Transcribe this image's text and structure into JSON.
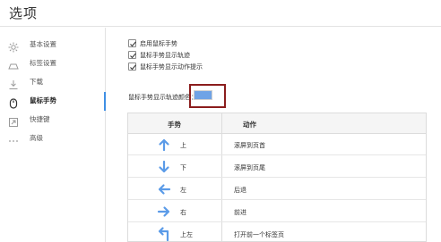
{
  "header": {
    "title": "选项"
  },
  "sidebar": {
    "items": [
      {
        "label": "基本设置",
        "icon": "gear-icon"
      },
      {
        "label": "标签设置",
        "icon": "tab-icon"
      },
      {
        "label": "下载",
        "icon": "download-icon"
      },
      {
        "label": "鼠标手势",
        "icon": "mouse-icon",
        "active": true
      },
      {
        "label": "快捷键",
        "icon": "shortcut-icon"
      },
      {
        "label": "高级",
        "icon": "more-icon"
      }
    ]
  },
  "options": [
    {
      "label": "启用鼠标手势",
      "checked": true
    },
    {
      "label": "鼠标手势显示轨迹",
      "checked": true
    },
    {
      "label": "鼠标手势显示动作提示",
      "checked": true
    }
  ],
  "trail_color": {
    "label": "鼠标手势显示轨迹颜色：",
    "value": "#6fa3e6"
  },
  "gesture_table": {
    "headers": {
      "gesture": "手势",
      "action": "动作"
    },
    "rows": [
      {
        "arrow": "arrow-up-icon",
        "gesture": "上",
        "action": "滚屏到页首"
      },
      {
        "arrow": "arrow-down-icon",
        "gesture": "下",
        "action": "滚屏到页尾"
      },
      {
        "arrow": "arrow-left-icon",
        "gesture": "左",
        "action": "后退"
      },
      {
        "arrow": "arrow-right-icon",
        "gesture": "右",
        "action": "前进"
      },
      {
        "arrow": "arrow-up-left-icon",
        "gesture": "上左",
        "action": "打开前一个标签页"
      }
    ]
  },
  "colors": {
    "accent": "#3f8fe4",
    "arrow": "#5b9be8",
    "highlight_frame": "#8b1d1d"
  }
}
